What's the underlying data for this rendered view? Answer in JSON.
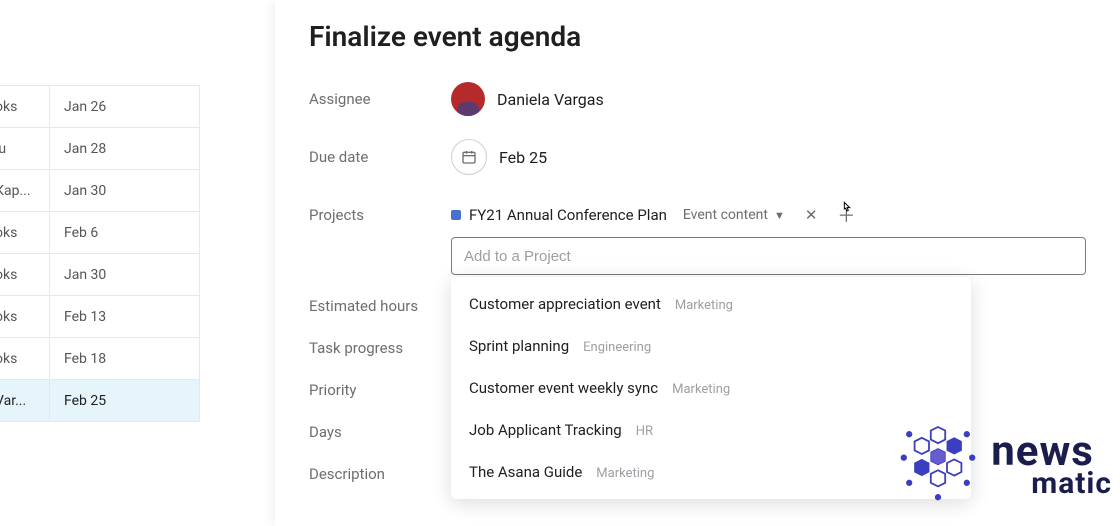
{
  "left_rows": [
    {
      "name": "oks",
      "date": "Jan 26"
    },
    {
      "name": "iu",
      "date": "Jan 28"
    },
    {
      "name": "Кар...",
      "date": "Jan 30"
    },
    {
      "name": "oks",
      "date": "Feb 6"
    },
    {
      "name": "oks",
      "date": "Jan 30"
    },
    {
      "name": "oks",
      "date": "Feb 13"
    },
    {
      "name": "oks",
      "date": "Feb 18"
    },
    {
      "name": "Var...",
      "date": "Feb 25",
      "selected": true
    }
  ],
  "task": {
    "title": "Finalize event agenda",
    "assignee_label": "Assignee",
    "assignee_name": "Daniela Vargas",
    "due_label": "Due date",
    "due_value": "Feb 25",
    "projects_label": "Projects",
    "project_name": "FY21 Annual Conference Plan",
    "project_section": "Event content",
    "project_color": "#4573d2",
    "search_placeholder": "Add to a Project",
    "dropdown": [
      {
        "name": "Customer appreciation event",
        "team": "Marketing"
      },
      {
        "name": "Sprint planning",
        "team": "Engineering"
      },
      {
        "name": "Customer event weekly sync",
        "team": "Marketing"
      },
      {
        "name": "Job Applicant Tracking",
        "team": "HR"
      },
      {
        "name": "The Asana Guide",
        "team": "Marketing"
      }
    ],
    "estimated_label": "Estimated hours",
    "progress_label": "Task progress",
    "priority_label": "Priority",
    "days_label": "Days",
    "description_label": "Description"
  },
  "watermark": {
    "line1": "news",
    "line2": "matic"
  }
}
